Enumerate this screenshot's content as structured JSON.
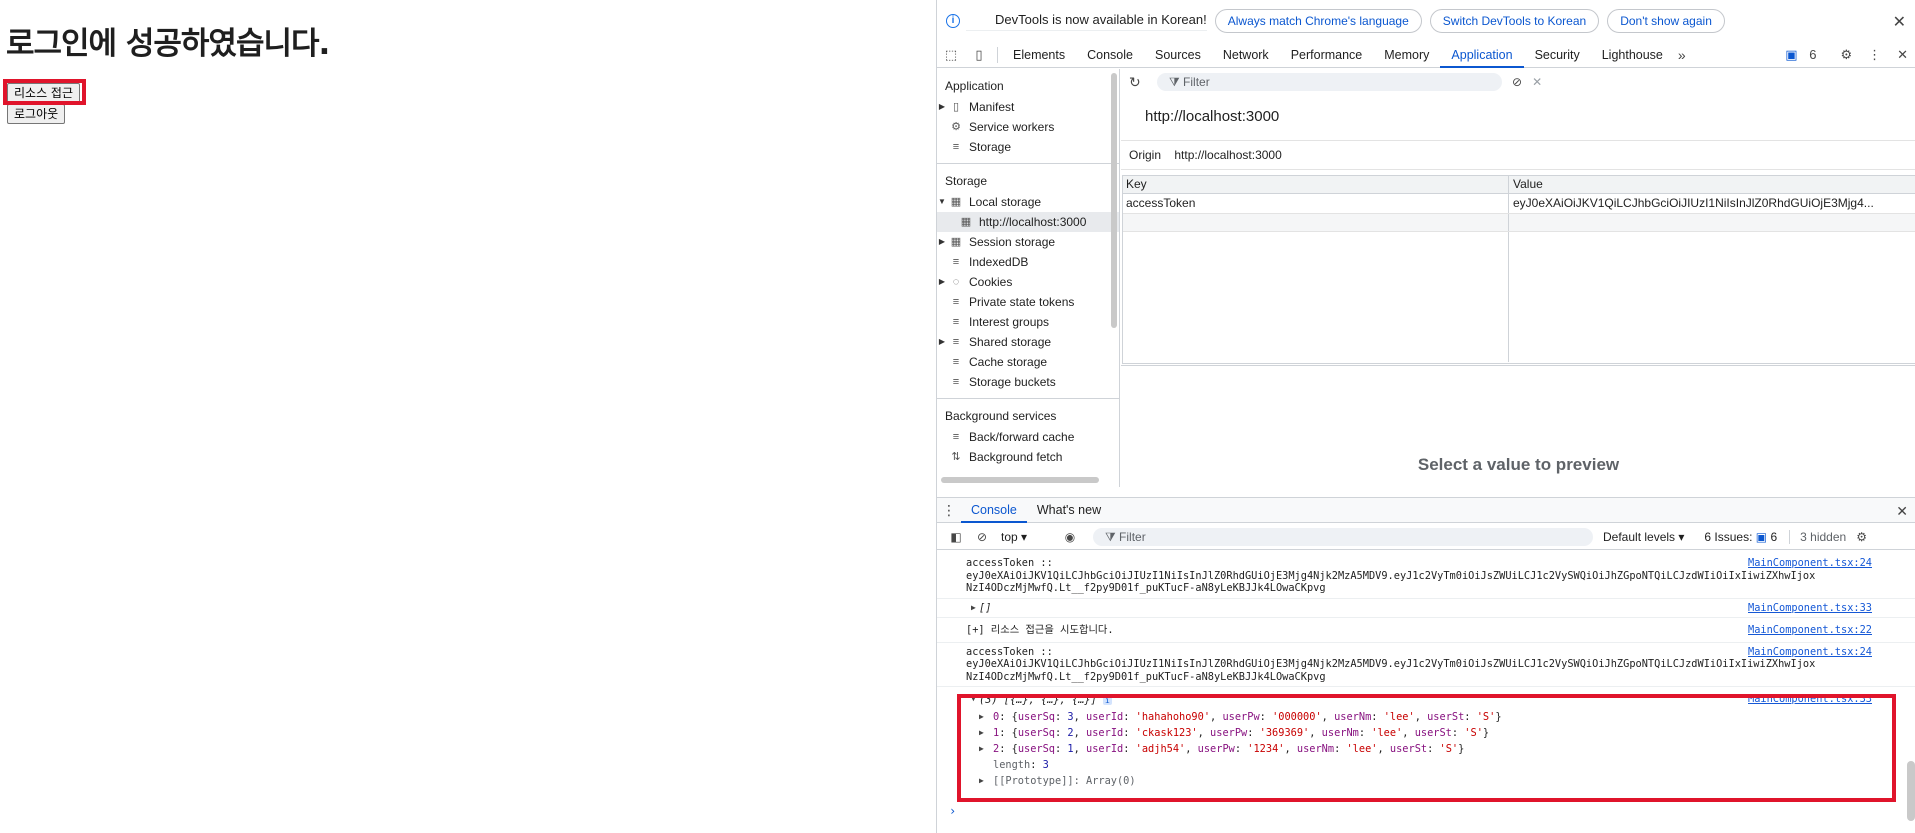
{
  "page": {
    "heading": "로그인에 성공하였습니다.",
    "resource_button": "리소스 접근",
    "logout_button": "로그아웃"
  },
  "infobar": {
    "message": "DevTools is now available in Korean!",
    "btn_match": "Always match Chrome's language",
    "btn_switch": "Switch DevTools to Korean",
    "btn_dont": "Don't show again"
  },
  "tabs": [
    "Elements",
    "Console",
    "Sources",
    "Network",
    "Performance",
    "Memory",
    "Application",
    "Security",
    "Lighthouse"
  ],
  "tab_active": "Application",
  "issues_badge": "6",
  "sidebar": {
    "application_title": "Application",
    "application_items": [
      "Manifest",
      "Service workers",
      "Storage"
    ],
    "storage_title": "Storage",
    "local_storage": "Local storage",
    "local_origin": "http://localhost:3000",
    "storage_items": [
      "Session storage",
      "IndexedDB",
      "Cookies",
      "Private state tokens",
      "Interest groups",
      "Shared storage",
      "Cache storage",
      "Storage buckets"
    ],
    "background_title": "Background services",
    "background_items": [
      "Back/forward cache",
      "Background fetch"
    ]
  },
  "main": {
    "filter_placeholder": "Filter",
    "origin_title": "http://localhost:3000",
    "origin_label": "Origin",
    "origin_value": "http://localhost:3000",
    "col_key": "Key",
    "col_value": "Value",
    "row_key": "accessToken",
    "row_value": "eyJ0eXAiOiJKV1QiLCJhbGciOiJIUzI1NiIsInJlZ0RhdGUiOjE3Mjg4...",
    "preview": "Select a value to preview"
  },
  "drawer": {
    "tab_console": "Console",
    "tab_whats_new": "What's new",
    "context": "top",
    "filter_placeholder": "Filter",
    "levels": "Default levels",
    "issues_label": "6 Issues:",
    "issues_count": "6",
    "hidden": "3 hidden"
  },
  "console": {
    "token_label": "accessToken ::",
    "token_line1": "eyJ0eXAiOiJKV1QiLCJhbGciOiJIUzI1NiIsInJlZ0RhdGUiOjE3Mjg4Njk2MzA5MDV9.eyJ1c2VyTm0iOiJsZWUiLCJ1c2VySWQiOiJhZGpoNTQiLCJzdWIiOiIxIiwiZXhwIjox",
    "token_line2": "NzI4ODczMjMwfQ.Lt__f2py9D01f_puKTucF-aN8yLeKBJJk4LOwaCKpvg",
    "src_24": "MainComponent.tsx:24",
    "src_33": "MainComponent.tsx:33",
    "src_22": "MainComponent.tsx:22",
    "empty_array": "[]",
    "attempt": "[+] 리소스 접근을 시도합니다.",
    "array_summary": "(3) [{…}, {…}, {…}]",
    "length_label": "length",
    "length_value": "3",
    "prototype": "[[Prototype]]: Array(0)",
    "users": [
      {
        "idx": "0",
        "userSq": "3",
        "userId": "'hahahoho90'",
        "userPw": "'000000'",
        "userNm": "'lee'",
        "userSt": "'S'"
      },
      {
        "idx": "1",
        "userSq": "2",
        "userId": "'ckask123'",
        "userPw": "'369369'",
        "userNm": "'lee'",
        "userSt": "'S'"
      },
      {
        "idx": "2",
        "userSq": "1",
        "userId": "'adjh54'",
        "userPw": "'1234'",
        "userNm": "'lee'",
        "userSt": "'S'"
      }
    ]
  },
  "colors": {
    "accent": "#0b57d0",
    "highlight_box": "#e0142b"
  }
}
